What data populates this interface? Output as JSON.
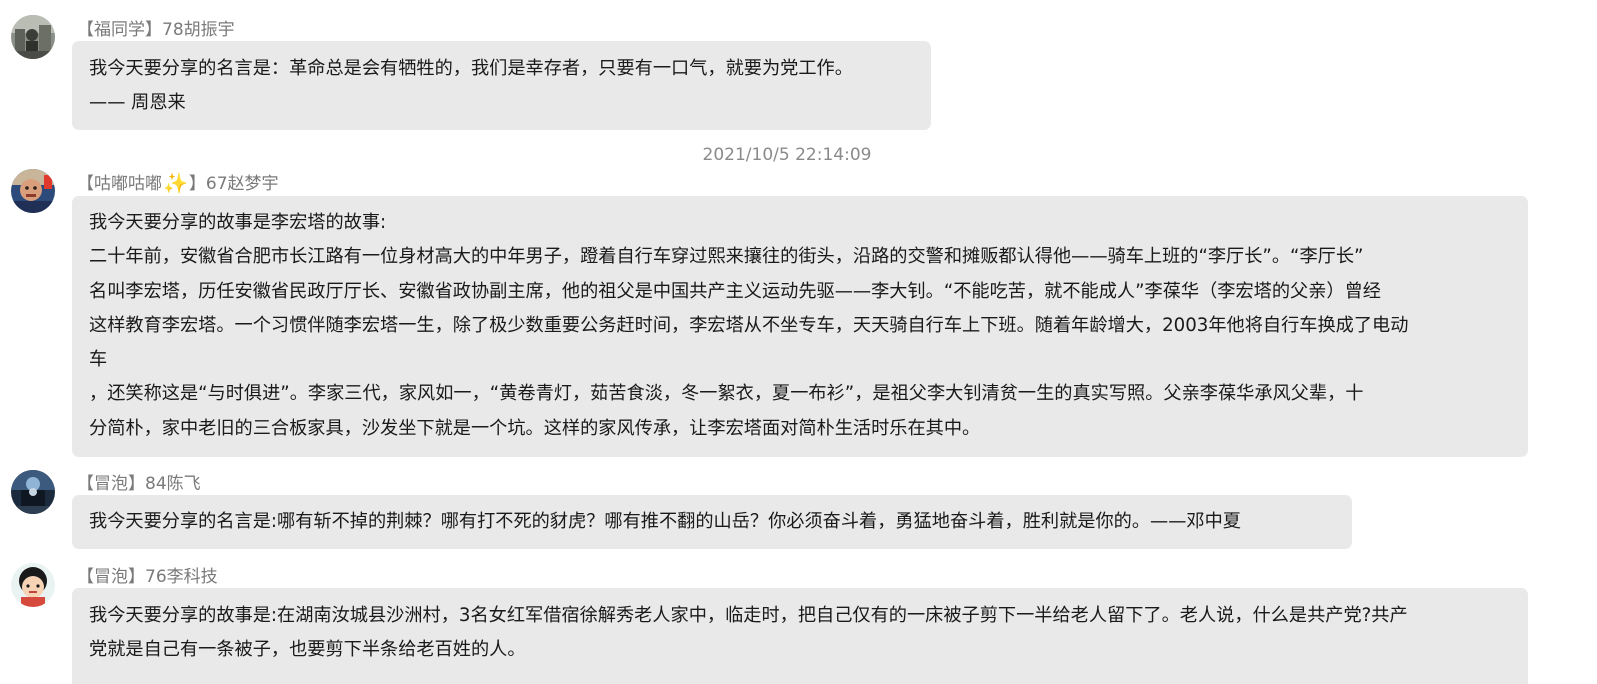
{
  "messages": [
    {
      "sender_tag": "【福同学】",
      "sender_name": "78胡振宇",
      "lines": [
        "我今天要分享的名言是：革命总是会有牺牲的，我们是幸存者，只要有一口气，就要为党工作。",
        "—— 周恩来"
      ]
    },
    {
      "timestamp": "2021/10/5 22:14:09"
    },
    {
      "sender_tag_open": "【咕嘟咕嘟",
      "sender_tag_close": "】",
      "sender_name": "67赵梦宇",
      "lines": [
        "我今天要分享的故事是李宏塔的故事:",
        "二十年前，安徽省合肥市长江路有一位身材高大的中年男子，蹬着自行车穿过熙来攘往的街头，沿路的交警和摊贩都认得他——骑车上班的“李厅长”。“李厅长”",
        "名叫李宏塔，历任安徽省民政厅厅长、安徽省政协副主席，他的祖父是中国共产主义运动先驱——李大钊。“不能吃苦，就不能成人”李葆华（李宏塔的父亲）曾经",
        "这样教育李宏塔。一个习惯伴随李宏塔一生，除了极少数重要公务赶时间，李宏塔从不坐专车，天天骑自行车上下班。随着年龄增大，2003年他将自行车换成了电动",
        "车",
        "，还笑称这是“与时俱进”。李家三代，家风如一，“黄卷青灯，茹苦食淡，冬一絮衣，夏一布衫”，是祖父李大钊清贫一生的真实写照。父亲李葆华承风父辈，十",
        "分简朴，家中老旧的三合板家具，沙发坐下就是一个坑。这样的家风传承，让李宏塔面对简朴生活时乐在其中。"
      ]
    },
    {
      "sender_tag": "【冒泡】",
      "sender_name": "84陈飞",
      "lines": [
        "我今天要分享的名言是:哪有斩不掉的荆棘？哪有打不死的豺虎？哪有推不翻的山岳？你必须奋斗着，勇猛地奋斗着，胜利就是你的。——邓中夏"
      ]
    },
    {
      "sender_tag": "【冒泡】",
      "sender_name": "76李科技",
      "lines": [
        "我今天要分享的故事是:在湖南汝城县沙洲村，3名女红军借宿徐解秀老人家中，临走时，把自己仅有的一床被子剪下一半给老人留下了。老人说，什么是共产党?共产",
        "党就是自己有一条被子，也要剪下半条给老百姓的人。"
      ]
    }
  ],
  "icons": {
    "title_badge_icon": "star-sparkle-icon",
    "title_badge_color": "#f5b01d"
  },
  "colors": {
    "bubble_bg": "#e9e9e9",
    "sender_text": "#7a7a7a",
    "timestamp_text": "#8a8a8a"
  }
}
